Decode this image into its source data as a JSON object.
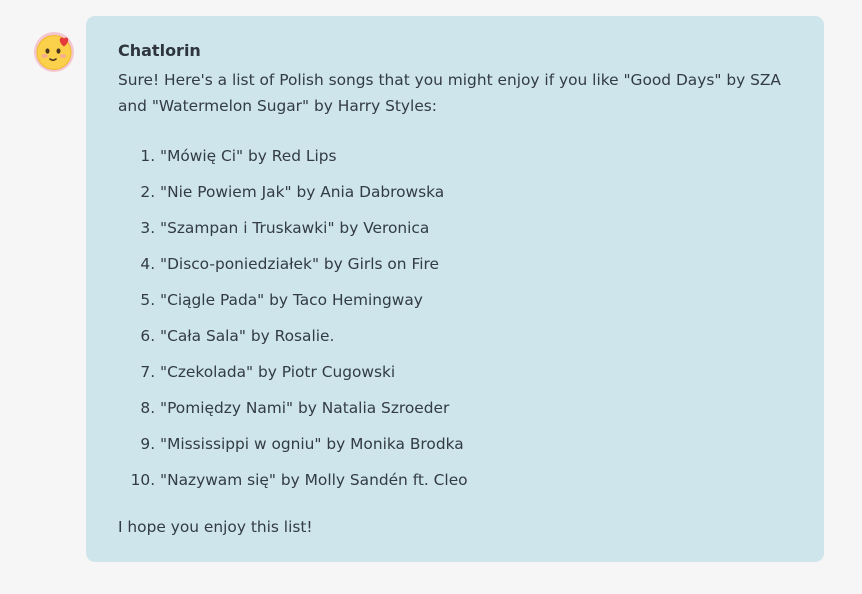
{
  "message": {
    "avatar_icon": "smiling-face-with-heart-icon",
    "sender": "Chatlorin",
    "intro": "Sure! Here's a list of Polish songs that you might enjoy if you like \"Good Days\" by SZA and \"Watermelon Sugar\" by Harry Styles:",
    "songs": [
      "\"Mówię Ci\" by Red Lips",
      "\"Nie Powiem Jak\" by Ania Dabrowska",
      "\"Szampan i Truskawki\" by Veronica",
      "\"Disco-poniedziałek\" by Girls on Fire",
      "\"Ciągle Pada\" by Taco Hemingway",
      "\"Cała Sala\" by Rosalie.",
      "\"Czekolada\" by Piotr Cugowski",
      "\"Pomiędzy Nami\" by Natalia Szroeder",
      "\"Mississippi w ogniu\" by Monika Brodka",
      "\"Nazywam się\" by Molly Sandén ft. Cleo"
    ],
    "outro": "I hope you enjoy this list!"
  },
  "colors": {
    "page_background": "#f6f6f7",
    "bubble_background": "#cde5eb",
    "text": "#333b44",
    "avatar_face": "#fbd04a",
    "heart": "#e63a3a"
  }
}
